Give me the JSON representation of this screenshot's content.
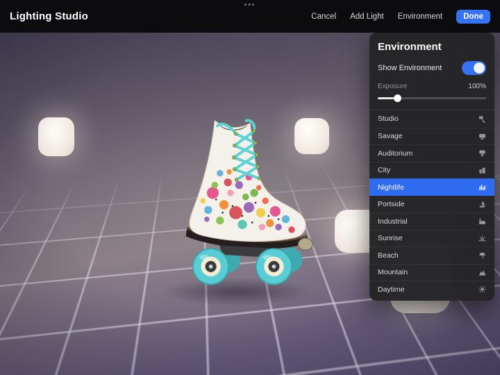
{
  "topbar": {
    "title": "Lighting Studio",
    "overflow_dots": "•••",
    "cancel_label": "Cancel",
    "add_light_label": "Add Light",
    "environment_label": "Environment",
    "done_label": "Done"
  },
  "environment_panel": {
    "title": "Environment",
    "show_environment": {
      "label": "Show Environment",
      "enabled": true
    },
    "exposure": {
      "label": "Exposure",
      "value": "100%",
      "slider_position_pct": 18
    },
    "options": [
      {
        "label": "Studio",
        "icon": "studio-light-icon",
        "selected": false
      },
      {
        "label": "Savage",
        "icon": "monitor-icon",
        "selected": false
      },
      {
        "label": "Auditorium",
        "icon": "auditorium-icon",
        "selected": false
      },
      {
        "label": "City",
        "icon": "city-icon",
        "selected": false
      },
      {
        "label": "Nightlife",
        "icon": "nightlife-icon",
        "selected": true
      },
      {
        "label": "Portside",
        "icon": "boat-icon",
        "selected": false
      },
      {
        "label": "Industrial",
        "icon": "factory-icon",
        "selected": false
      },
      {
        "label": "Sunrise",
        "icon": "sunrise-icon",
        "selected": false
      },
      {
        "label": "Beach",
        "icon": "beach-umbrella-icon",
        "selected": false
      },
      {
        "label": "Mountain",
        "icon": "mountain-icon",
        "selected": false
      },
      {
        "label": "Daytime",
        "icon": "sun-icon",
        "selected": false
      }
    ]
  },
  "colors": {
    "accent": "#3672f4",
    "selected_row": "#2e6bf0",
    "topbar_bg": "#0c0c0e",
    "panel_bg": "#252527"
  }
}
